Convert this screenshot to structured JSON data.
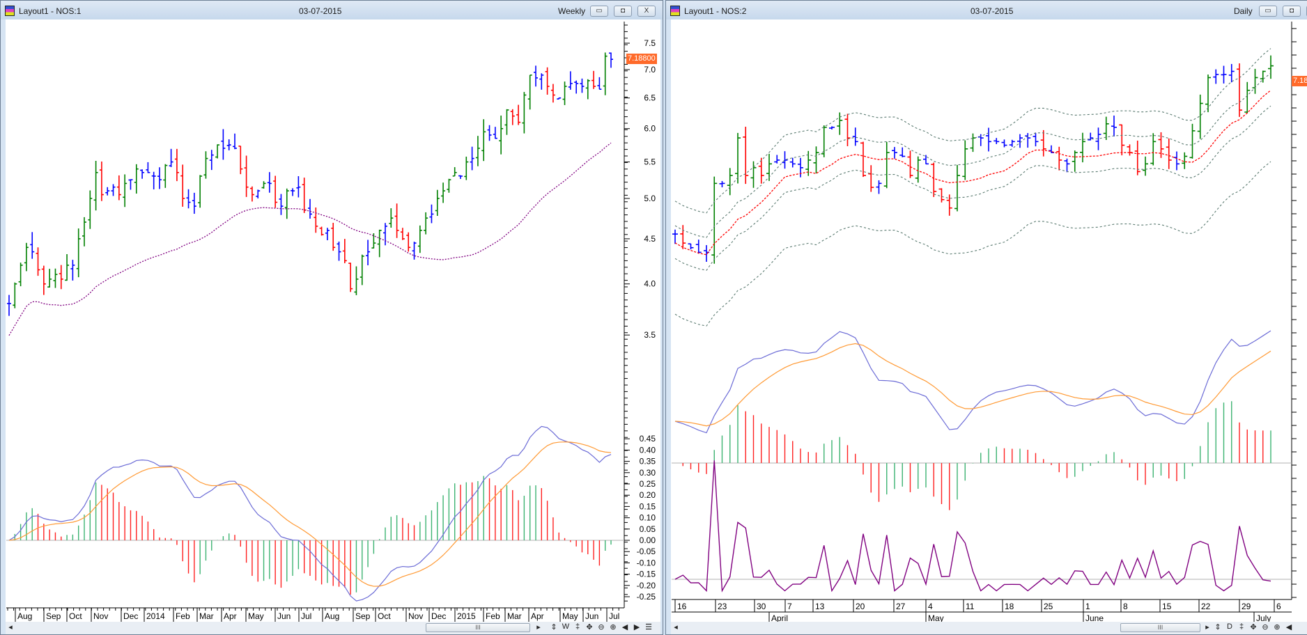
{
  "windows": [
    {
      "title": "Layout1 - NOS:1",
      "date": "03-07-2015",
      "period": "Weekly",
      "buttons": {
        "minimize": "▭",
        "restore": "◘",
        "close": "X"
      },
      "last_price": "7.18800",
      "toolbar": [
        "⇕",
        "W",
        "‡",
        "✥",
        "⊖",
        "⊕",
        "◀",
        "▶",
        "☰"
      ],
      "scroll_thumb": "III"
    },
    {
      "title": "Layout1 - NOS:2",
      "date": "03-07-2015",
      "period": "Daily",
      "buttons": {
        "minimize": "▭",
        "restore": "◘",
        "close": "X"
      },
      "last_price": "7.18",
      "toolbar": [
        "⇕",
        "D",
        "‡",
        "✥",
        "⊖",
        "⊕",
        "◀"
      ],
      "scroll_thumb": "III"
    }
  ],
  "colors": {
    "up": "#008000",
    "down": "#ff0000",
    "neutral": "#0000ff",
    "ma": "#800080",
    "macd": "#6b6bd6",
    "signal": "#ff9933",
    "band": "#5a7a70",
    "ma_daily": "#ff0000",
    "osc": "#800080",
    "price_tag": "#ff6a2a"
  },
  "chart_data": [
    {
      "type": "ohlc",
      "name": "NOS weekly",
      "y_ticks": [
        "7.5",
        "7.0",
        "6.5",
        "6.0",
        "5.5",
        "5.0",
        "4.5",
        "4.0",
        "3.5"
      ],
      "y_tick_values": [
        7.5,
        7.0,
        6.5,
        6.0,
        5.5,
        5.0,
        4.5,
        4.0,
        3.5
      ],
      "macd_ticks": [
        "0.45",
        "0.40",
        "0.35",
        "0.30",
        "0.25",
        "0.20",
        "0.15",
        "0.10",
        "0.05",
        "0.00",
        "-0.05",
        "-0.10",
        "-0.15",
        "-0.20",
        "-0.25"
      ],
      "macd_tick_values": [
        0.45,
        0.4,
        0.35,
        0.3,
        0.25,
        0.2,
        0.15,
        0.1,
        0.05,
        0.0,
        -0.05,
        -0.1,
        -0.15,
        -0.2,
        -0.25
      ],
      "x_labels": [
        "Aug",
        "Sep",
        "Oct",
        "Nov",
        "Dec",
        "2014",
        "Feb",
        "Mar",
        "Apr",
        "May",
        "Jun",
        "Jul",
        "Aug",
        "Sep",
        "Oct",
        "Nov",
        "Dec",
        "2015",
        "Feb",
        "Mar",
        "Apr",
        "May",
        "Jun",
        "Jul"
      ],
      "closes": [
        3.8,
        4.0,
        4.2,
        4.4,
        4.35,
        4.15,
        4.0,
        4.05,
        4.1,
        4.05,
        4.2,
        4.2,
        4.5,
        4.7,
        5.0,
        5.35,
        5.05,
        5.1,
        5.15,
        5.05,
        5.2,
        5.25,
        5.4,
        5.35,
        5.35,
        5.3,
        5.25,
        5.45,
        5.5,
        5.35,
        5.0,
        4.95,
        4.9,
        5.3,
        5.55,
        5.6,
        5.75,
        5.7,
        5.75,
        5.7,
        5.4,
        5.15,
        5.05,
        5.1,
        5.2,
        5.2,
        4.95,
        4.9,
        5.1,
        5.1,
        5.15,
        4.85,
        4.8,
        4.65,
        4.55,
        4.6,
        4.4,
        4.35,
        4.25,
        3.95,
        4.05,
        4.3,
        4.35,
        4.45,
        4.6,
        4.65,
        4.75,
        4.6,
        4.5,
        4.4,
        4.45,
        4.6,
        4.75,
        4.8,
        5.0,
        5.1,
        5.25,
        5.35,
        5.3,
        5.5,
        5.55,
        5.7,
        5.95,
        5.9,
        5.85,
        6.0,
        6.3,
        6.2,
        6.1,
        6.55,
        6.9,
        6.85,
        6.9,
        6.7,
        6.55,
        6.5,
        6.7,
        6.75,
        6.75,
        6.7,
        6.8,
        6.7,
        6.65,
        7.25,
        7.19
      ],
      "indicators": [
        "SMA 30 (dotted)",
        "MACD 12/26/9 with histogram"
      ]
    },
    {
      "type": "ohlc",
      "name": "NOS daily",
      "x_labels": [
        "16",
        "23",
        "30",
        "7",
        "13",
        "20",
        "27",
        "4",
        "11",
        "18",
        "25",
        "1",
        "8",
        "15",
        "22",
        "29",
        "6"
      ],
      "month_labels": [
        "April",
        "May",
        "June",
        "July"
      ],
      "closes": [
        4.9,
        4.8,
        4.75,
        4.7,
        4.7,
        5.5,
        5.5,
        5.6,
        6.1,
        5.6,
        5.7,
        5.6,
        5.75,
        5.8,
        5.8,
        5.75,
        5.7,
        5.8,
        5.9,
        6.25,
        6.25,
        6.35,
        6.1,
        6.05,
        5.6,
        5.45,
        5.5,
        5.9,
        5.9,
        5.85,
        5.6,
        5.8,
        5.75,
        5.4,
        5.3,
        5.2,
        5.6,
        5.95,
        6.1,
        6.1,
        6.05,
        6.05,
        6.0,
        6.05,
        6.1,
        6.1,
        6.05,
        5.95,
        5.9,
        5.8,
        5.75,
        5.9,
        6.05,
        6.1,
        6.15,
        6.3,
        6.25,
        6.0,
        5.9,
        5.65,
        5.75,
        6.05,
        5.95,
        5.8,
        5.75,
        5.85,
        6.2,
        6.6,
        7.0,
        7.05,
        7.05,
        7.1,
        6.5,
        6.8,
        7.0,
        7.1,
        7.19
      ],
      "indicators": [
        "SMA 10 (red dotted)",
        "Envelopes (grey dotted)",
        "MACD with histogram",
        "Oscillator"
      ]
    }
  ]
}
